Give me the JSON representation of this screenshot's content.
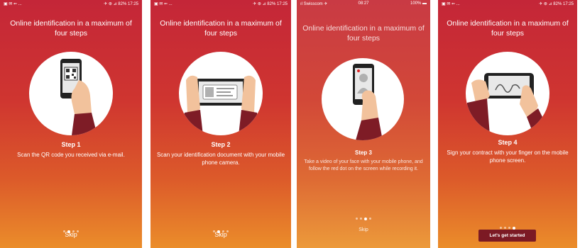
{
  "screens": [
    {
      "status": {
        "left": "▣ ✉ ⇐ ...",
        "right": "✈ ⊛ ⊿ 82% 17:25",
        "center": ""
      },
      "title": "Online identification in a maximum of four steps",
      "illustration": "qr-code-scan",
      "step_label": "Step 1",
      "description": "Scan the QR code you received via e-mail.",
      "page_indicator": {
        "total": 4,
        "active": 1
      },
      "skip_label": "Skip"
    },
    {
      "status": {
        "left": "▣ ✉ ⇐ ...",
        "right": "✈ ⊛ ⊿ 82% 17:25",
        "center": ""
      },
      "title": "Online identification in a maximum of four steps",
      "illustration": "document-scan",
      "step_label": "Step 2",
      "description": "Scan your identification document with your mobile phone camera.",
      "page_indicator": {
        "total": 4,
        "active": 2
      },
      "skip_label": "Skip"
    },
    {
      "status": {
        "left": "ıl Swisscom  ✈",
        "center": "08:27",
        "right": "100% ▬"
      },
      "title": "Online identification in a maximum of four steps",
      "illustration": "selfie-video",
      "step_label": "Step 3",
      "description": "Take a video of your face with your mobile phone, and follow the red dot on the screen while recording it.",
      "page_indicator": {
        "total": 4,
        "active": 3
      },
      "skip_label": "Skip"
    },
    {
      "status": {
        "left": "▣ ✉ ⇐ ...",
        "right": "✈ ⊛ ⊿ 82% 17:25",
        "center": ""
      },
      "title": "Online identification in a maximum of four steps",
      "illustration": "finger-signature",
      "step_label": "Step 4",
      "description": "Sign your contract with your finger on the mobile phone screen.",
      "page_indicator": {
        "total": 4,
        "active": 4
      },
      "cta_label": "Let's get started"
    }
  ],
  "colors": {
    "gradient_top": "#c42638",
    "gradient_bottom": "#eb8d2a",
    "button": "#7c1a24",
    "sleeve": "#7e1c26",
    "skin": "#f2c29c"
  }
}
